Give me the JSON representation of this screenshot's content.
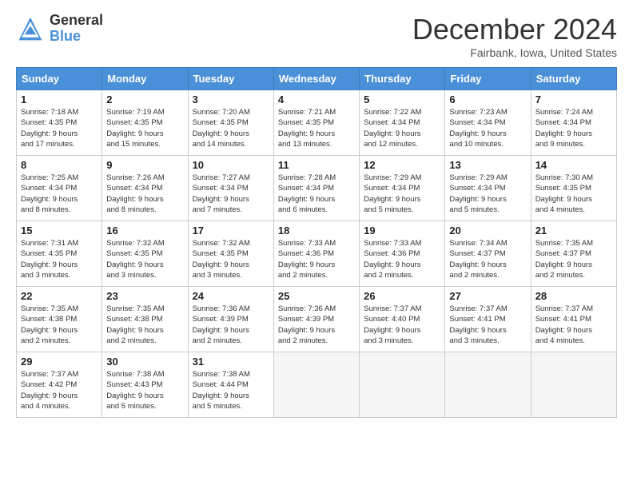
{
  "logo": {
    "general": "General",
    "blue": "Blue"
  },
  "title": "December 2024",
  "location": "Fairbank, Iowa, United States",
  "days_header": [
    "Sunday",
    "Monday",
    "Tuesday",
    "Wednesday",
    "Thursday",
    "Friday",
    "Saturday"
  ],
  "weeks": [
    [
      {
        "day": "1",
        "info": "Sunrise: 7:18 AM\nSunset: 4:35 PM\nDaylight: 9 hours\nand 17 minutes."
      },
      {
        "day": "2",
        "info": "Sunrise: 7:19 AM\nSunset: 4:35 PM\nDaylight: 9 hours\nand 15 minutes."
      },
      {
        "day": "3",
        "info": "Sunrise: 7:20 AM\nSunset: 4:35 PM\nDaylight: 9 hours\nand 14 minutes."
      },
      {
        "day": "4",
        "info": "Sunrise: 7:21 AM\nSunset: 4:35 PM\nDaylight: 9 hours\nand 13 minutes."
      },
      {
        "day": "5",
        "info": "Sunrise: 7:22 AM\nSunset: 4:34 PM\nDaylight: 9 hours\nand 12 minutes."
      },
      {
        "day": "6",
        "info": "Sunrise: 7:23 AM\nSunset: 4:34 PM\nDaylight: 9 hours\nand 10 minutes."
      },
      {
        "day": "7",
        "info": "Sunrise: 7:24 AM\nSunset: 4:34 PM\nDaylight: 9 hours\nand 9 minutes."
      }
    ],
    [
      {
        "day": "8",
        "info": "Sunrise: 7:25 AM\nSunset: 4:34 PM\nDaylight: 9 hours\nand 8 minutes."
      },
      {
        "day": "9",
        "info": "Sunrise: 7:26 AM\nSunset: 4:34 PM\nDaylight: 9 hours\nand 8 minutes."
      },
      {
        "day": "10",
        "info": "Sunrise: 7:27 AM\nSunset: 4:34 PM\nDaylight: 9 hours\nand 7 minutes."
      },
      {
        "day": "11",
        "info": "Sunrise: 7:28 AM\nSunset: 4:34 PM\nDaylight: 9 hours\nand 6 minutes."
      },
      {
        "day": "12",
        "info": "Sunrise: 7:29 AM\nSunset: 4:34 PM\nDaylight: 9 hours\nand 5 minutes."
      },
      {
        "day": "13",
        "info": "Sunrise: 7:29 AM\nSunset: 4:34 PM\nDaylight: 9 hours\nand 5 minutes."
      },
      {
        "day": "14",
        "info": "Sunrise: 7:30 AM\nSunset: 4:35 PM\nDaylight: 9 hours\nand 4 minutes."
      }
    ],
    [
      {
        "day": "15",
        "info": "Sunrise: 7:31 AM\nSunset: 4:35 PM\nDaylight: 9 hours\nand 3 minutes."
      },
      {
        "day": "16",
        "info": "Sunrise: 7:32 AM\nSunset: 4:35 PM\nDaylight: 9 hours\nand 3 minutes."
      },
      {
        "day": "17",
        "info": "Sunrise: 7:32 AM\nSunset: 4:35 PM\nDaylight: 9 hours\nand 3 minutes."
      },
      {
        "day": "18",
        "info": "Sunrise: 7:33 AM\nSunset: 4:36 PM\nDaylight: 9 hours\nand 2 minutes."
      },
      {
        "day": "19",
        "info": "Sunrise: 7:33 AM\nSunset: 4:36 PM\nDaylight: 9 hours\nand 2 minutes."
      },
      {
        "day": "20",
        "info": "Sunrise: 7:34 AM\nSunset: 4:37 PM\nDaylight: 9 hours\nand 2 minutes."
      },
      {
        "day": "21",
        "info": "Sunrise: 7:35 AM\nSunset: 4:37 PM\nDaylight: 9 hours\nand 2 minutes."
      }
    ],
    [
      {
        "day": "22",
        "info": "Sunrise: 7:35 AM\nSunset: 4:38 PM\nDaylight: 9 hours\nand 2 minutes."
      },
      {
        "day": "23",
        "info": "Sunrise: 7:35 AM\nSunset: 4:38 PM\nDaylight: 9 hours\nand 2 minutes."
      },
      {
        "day": "24",
        "info": "Sunrise: 7:36 AM\nSunset: 4:39 PM\nDaylight: 9 hours\nand 2 minutes."
      },
      {
        "day": "25",
        "info": "Sunrise: 7:36 AM\nSunset: 4:39 PM\nDaylight: 9 hours\nand 2 minutes."
      },
      {
        "day": "26",
        "info": "Sunrise: 7:37 AM\nSunset: 4:40 PM\nDaylight: 9 hours\nand 3 minutes."
      },
      {
        "day": "27",
        "info": "Sunrise: 7:37 AM\nSunset: 4:41 PM\nDaylight: 9 hours\nand 3 minutes."
      },
      {
        "day": "28",
        "info": "Sunrise: 7:37 AM\nSunset: 4:41 PM\nDaylight: 9 hours\nand 4 minutes."
      }
    ],
    [
      {
        "day": "29",
        "info": "Sunrise: 7:37 AM\nSunset: 4:42 PM\nDaylight: 9 hours\nand 4 minutes."
      },
      {
        "day": "30",
        "info": "Sunrise: 7:38 AM\nSunset: 4:43 PM\nDaylight: 9 hours\nand 5 minutes."
      },
      {
        "day": "31",
        "info": "Sunrise: 7:38 AM\nSunset: 4:44 PM\nDaylight: 9 hours\nand 5 minutes."
      },
      null,
      null,
      null,
      null
    ]
  ]
}
